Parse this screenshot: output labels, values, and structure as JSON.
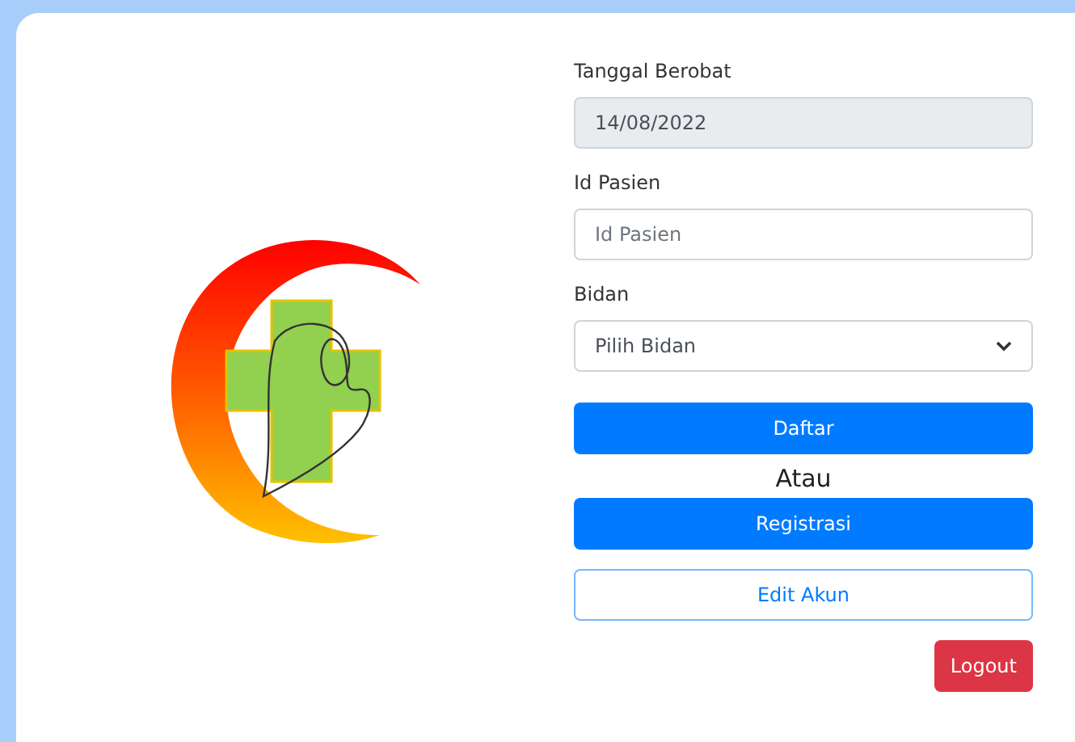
{
  "form": {
    "fields": [
      {
        "kind": "date",
        "label": "Tanggal Berobat",
        "value": "14/08/2022",
        "disabled": true
      },
      {
        "kind": "text",
        "label": "Id Pasien",
        "placeholder": "Id Pasien"
      },
      {
        "kind": "select",
        "label": "Bidan",
        "value": "Pilih Bidan"
      }
    ],
    "actions": [
      {
        "kind": "primary",
        "label": "Daftar"
      },
      {
        "kind": "separator",
        "label": "Atau"
      },
      {
        "kind": "primary",
        "label": "Registrasi"
      },
      {
        "kind": "outline",
        "label": "Edit Akun"
      },
      {
        "kind": "danger",
        "label": "Logout"
      }
    ]
  }
}
